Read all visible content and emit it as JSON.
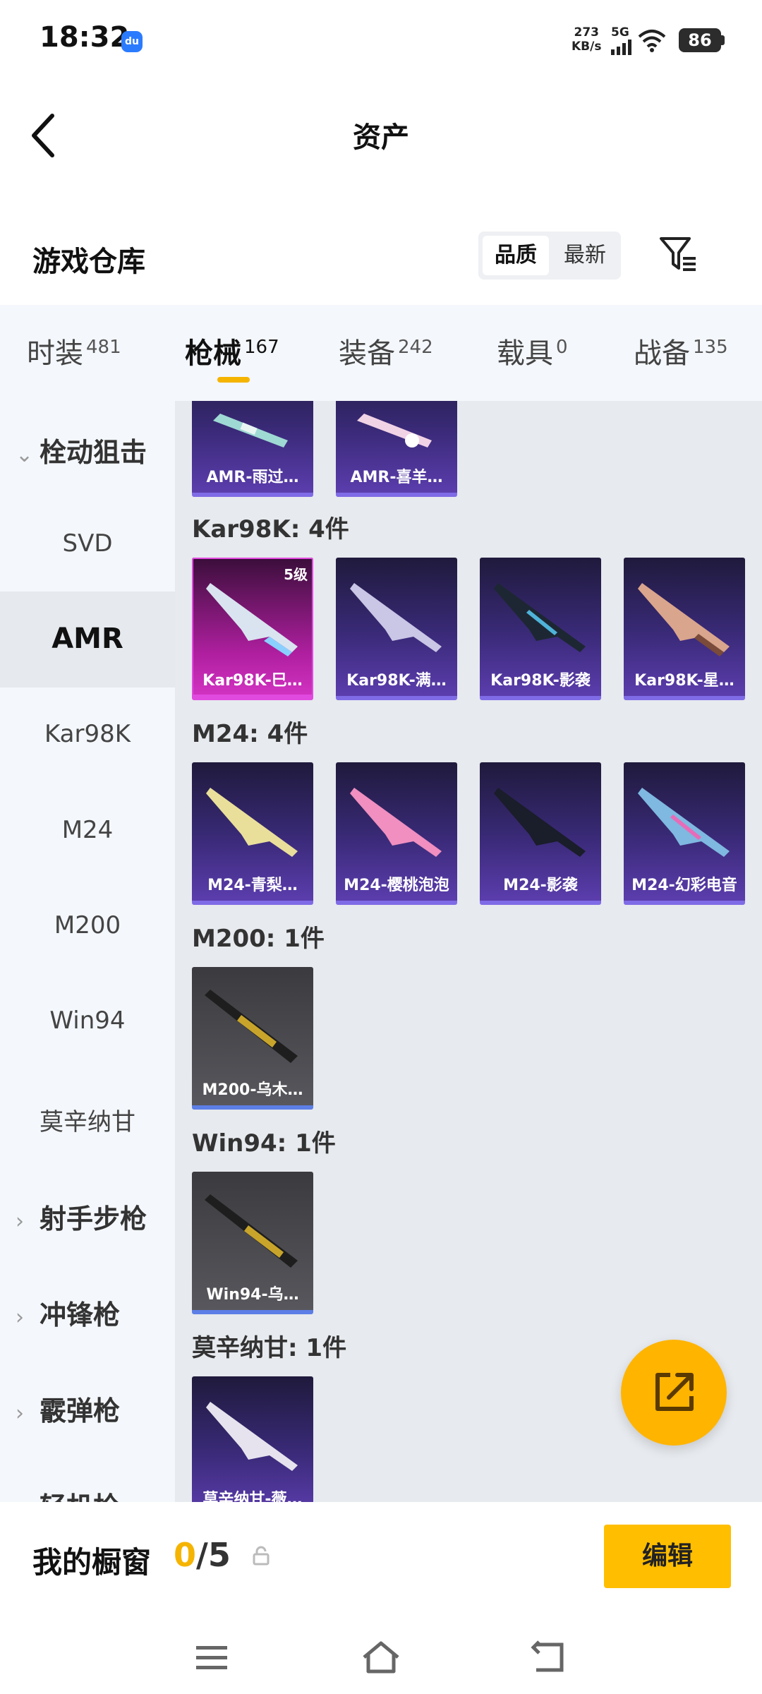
{
  "status_bar": {
    "time": "18:32",
    "app_badge": "du",
    "net_speed": "273",
    "net_unit": "KB/s",
    "network": "5G",
    "battery": "86"
  },
  "nav": {
    "title": "资产",
    "back_icon": "chevron-left-icon"
  },
  "warehouse": {
    "title": "游戏仓库",
    "sort_options": [
      "品质",
      "最新"
    ],
    "active_sort": "品质",
    "filter_icon": "filter-icon"
  },
  "tabs": [
    {
      "label": "时装",
      "count": "481"
    },
    {
      "label": "枪械",
      "count": "167",
      "active": true
    },
    {
      "label": "装备",
      "count": "242"
    },
    {
      "label": "载具",
      "count": "0"
    },
    {
      "label": "战备",
      "count": "135"
    }
  ],
  "sidebar": {
    "group_open": "栓动狙击",
    "items": [
      "SVD",
      "AMR",
      "Kar98K",
      "M24",
      "M200",
      "Win94",
      "莫辛纳甘"
    ],
    "selected": "AMR",
    "groups_collapsed": [
      "射手步枪",
      "冲锋枪",
      "霰弹枪",
      "轻机枪"
    ]
  },
  "content": {
    "amr_cards": [
      "AMR-雨过…",
      "AMR-喜羊…"
    ],
    "sections": [
      {
        "label": "Kar98K: 4件",
        "cards": [
          {
            "name": "Kar98K-巳…",
            "level": "5级",
            "style": "pink"
          },
          {
            "name": "Kar98K-满…",
            "style": "purple"
          },
          {
            "name": "Kar98K-影袭",
            "style": "purple"
          },
          {
            "name": "Kar98K-星…",
            "style": "purple"
          }
        ]
      },
      {
        "label": "M24: 4件",
        "cards": [
          {
            "name": "M24-青梨…",
            "style": "purple"
          },
          {
            "name": "M24-樱桃泡泡",
            "style": "purple"
          },
          {
            "name": "M24-影袭",
            "style": "purple"
          },
          {
            "name": "M24-幻彩电音",
            "style": "purple"
          }
        ]
      },
      {
        "label": "M200: 1件",
        "cards": [
          {
            "name": "M200-乌木…",
            "style": "grey"
          }
        ]
      },
      {
        "label": "Win94: 1件",
        "cards": [
          {
            "name": "Win94-乌…",
            "style": "grey"
          }
        ]
      },
      {
        "label": "莫辛纳甘: 1件",
        "cards": [
          {
            "name": "莫辛纳甘-薇…",
            "style": "purple"
          }
        ]
      }
    ]
  },
  "fab_icon": "share-external-icon",
  "showcase": {
    "label": "我的橱窗",
    "current": "0",
    "total": "/5",
    "edit_label": "编辑"
  },
  "system_nav": [
    "menu-icon",
    "home-icon",
    "back-icon"
  ],
  "colors": {
    "accent": "#ffbe00",
    "card_purple": "#3a2a78",
    "card_pink": "#b01fa0",
    "card_grey": "#57575d"
  }
}
